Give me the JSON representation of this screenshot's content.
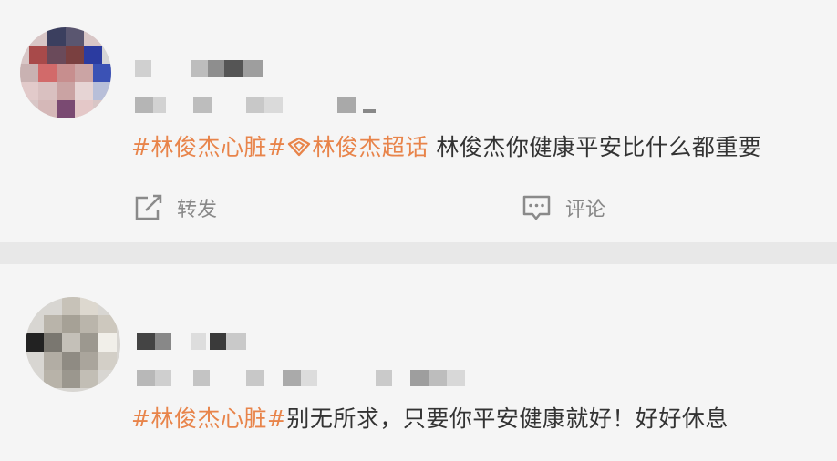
{
  "colors": {
    "topic": "#e8844a",
    "text": "#333333",
    "action": "#888888"
  },
  "posts": [
    {
      "topic1": "#林俊杰心脏#",
      "super_topic": "林俊杰超话",
      "text": " 林俊杰你健康平安比什么都重要",
      "actions": {
        "repost": "转发",
        "comment": "评论"
      }
    },
    {
      "topic1": "#林俊杰心脏#",
      "text": "别无所求，只要你平安健康就好！好好休息"
    }
  ],
  "icons": [
    "repost-icon",
    "comment-icon",
    "super-topic-icon"
  ]
}
